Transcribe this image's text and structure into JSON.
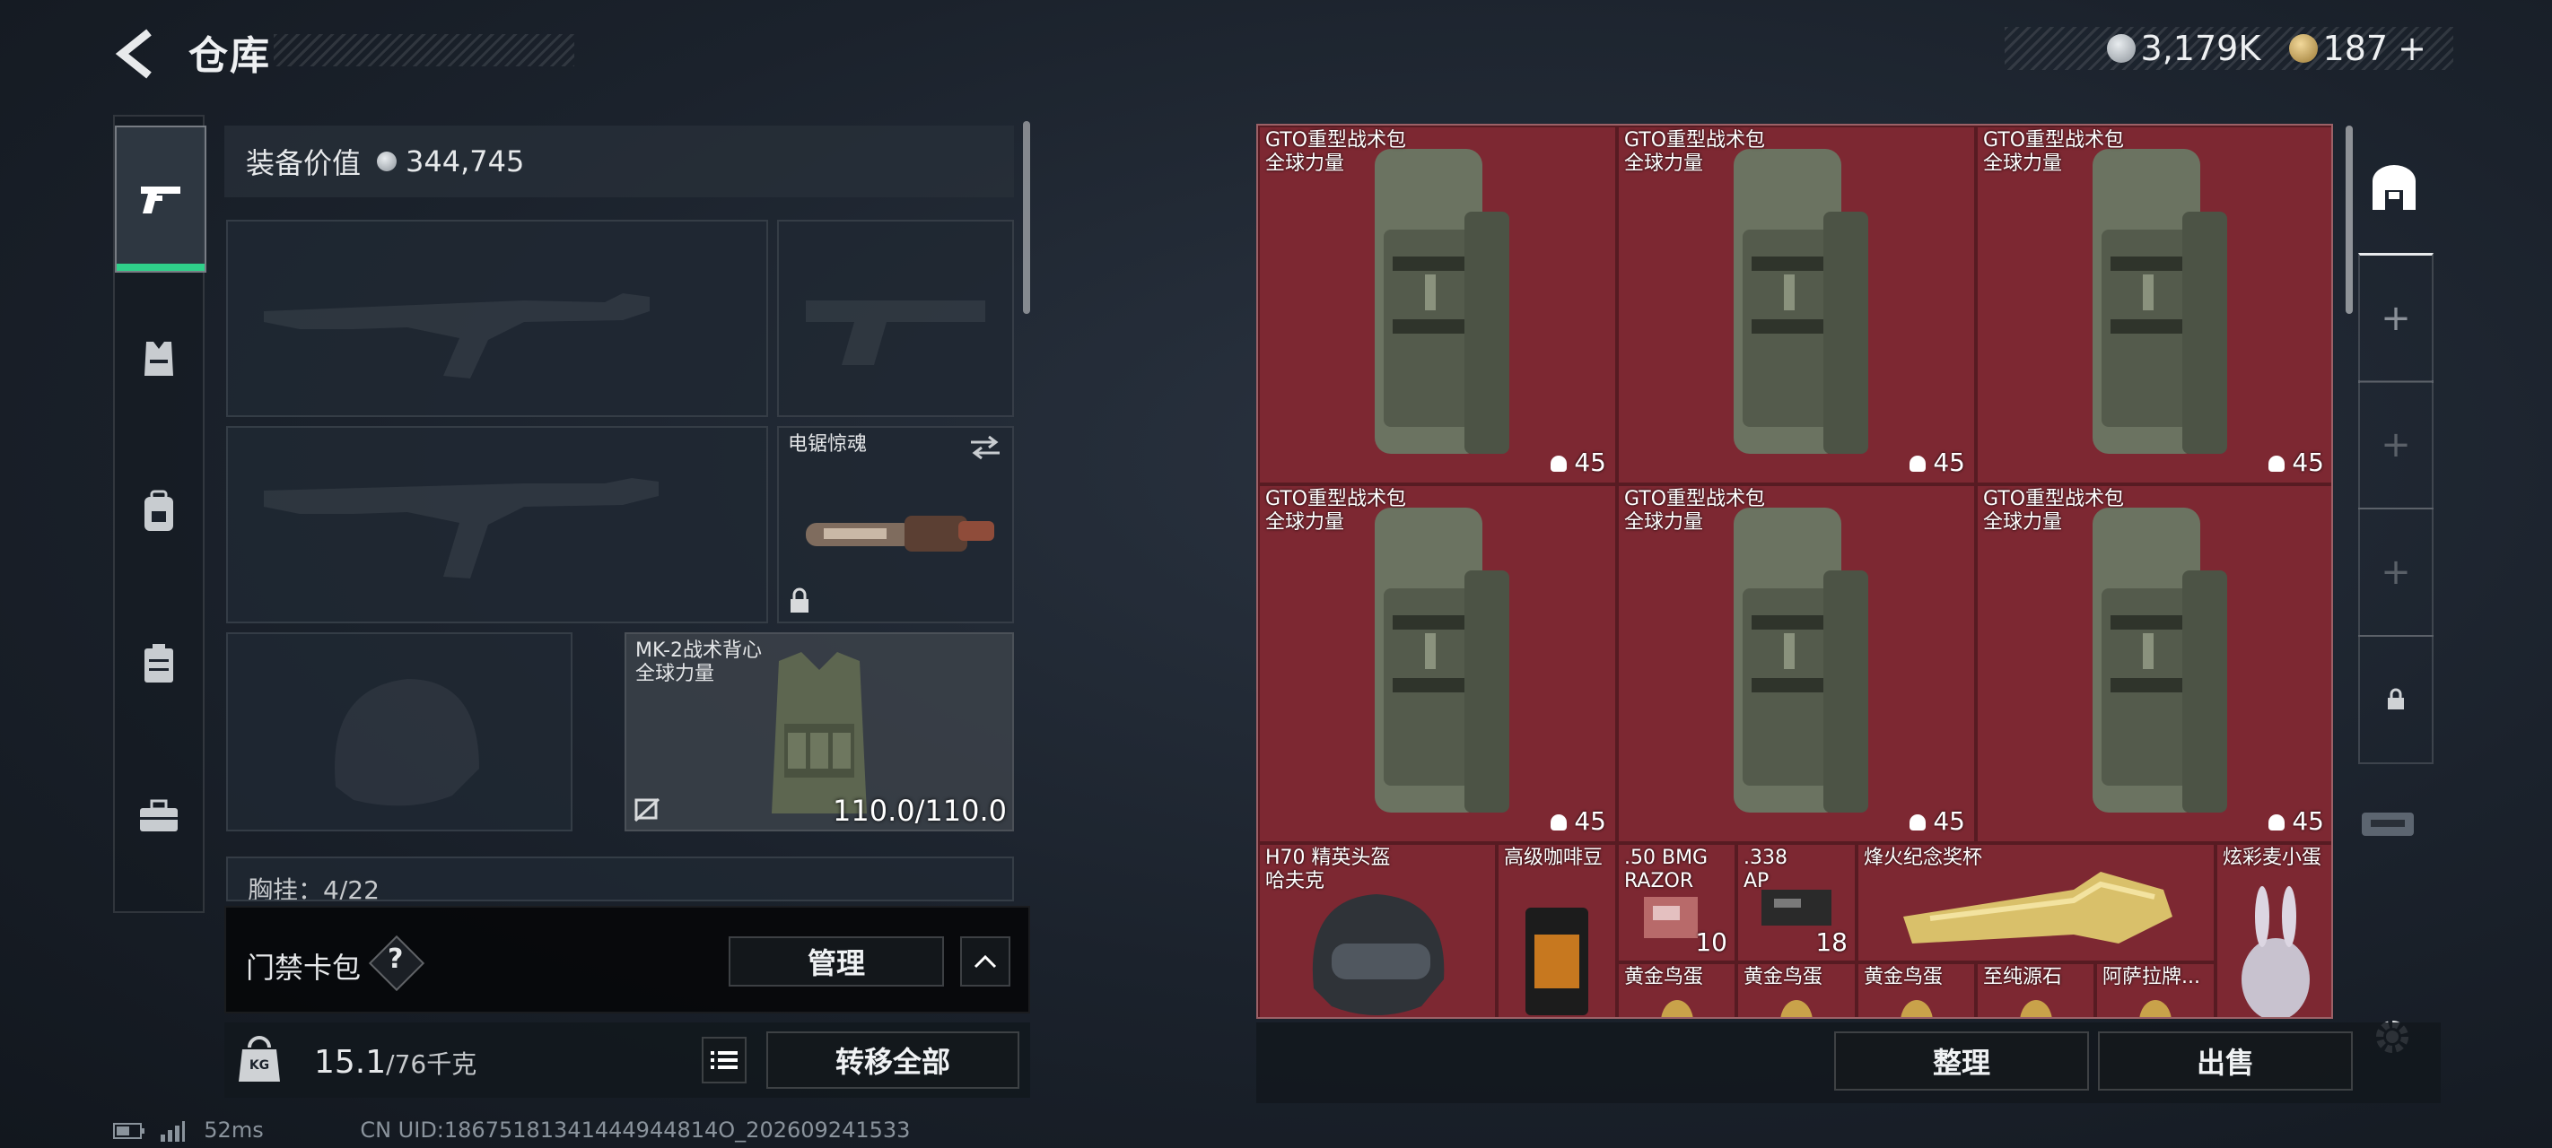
{
  "header": {
    "title": "仓库",
    "currency": [
      {
        "icon": "silver-coin-icon",
        "value": "3,179K",
        "color": "#b9bec4"
      },
      {
        "icon": "gold-triangle-coin-icon",
        "value": "187",
        "color": "#c9a45a"
      }
    ],
    "add_label": "+"
  },
  "rail": {
    "tabs": [
      {
        "icon": "pistol-icon",
        "active": true
      },
      {
        "icon": "vest-icon",
        "active": false
      },
      {
        "icon": "backpack-icon",
        "active": false
      },
      {
        "icon": "case-icon",
        "active": false
      },
      {
        "icon": "briefcase-icon",
        "active": false
      }
    ]
  },
  "loadout": {
    "value_label": "装备价值",
    "value": "344,745",
    "melee": {
      "label": "电锯惊魂"
    },
    "armor": {
      "label": "MK-2战术背心\n全球力量",
      "durability": "110.0/110.0"
    },
    "chest_rig_label": "胸挂：4/22"
  },
  "card_bag": {
    "label": "门禁卡包",
    "help": "?",
    "manage": "管理"
  },
  "weight": {
    "current": "15.1",
    "max": "/76千克",
    "kg_icon_text": "KG",
    "transfer_all": "转移全部"
  },
  "grid": {
    "backpacks": [
      {
        "name": "GTO重型战术包\n全球力量",
        "capacity": "45"
      },
      {
        "name": "GTO重型战术包\n全球力量",
        "capacity": "45"
      },
      {
        "name": "GTO重型战术包\n全球力量",
        "capacity": "45"
      },
      {
        "name": "GTO重型战术包\n全球力量",
        "capacity": "45"
      },
      {
        "name": "GTO重型战术包\n全球力量",
        "capacity": "45"
      },
      {
        "name": "GTO重型战术包\n全球力量",
        "capacity": "45"
      }
    ],
    "items": [
      {
        "name": "H70 精英头盔\n哈夫克"
      },
      {
        "name": "高级咖啡豆"
      },
      {
        "name": ".50 BMG\nRAZOR",
        "qty": "10"
      },
      {
        "name": ".338\nAP",
        "qty": "18"
      },
      {
        "name": "烽火纪念奖杯"
      },
      {
        "name": "炫彩麦小蛋"
      },
      {
        "name": "黄金鸟蛋"
      },
      {
        "name": "黄金鸟蛋"
      },
      {
        "name": "黄金鸟蛋"
      },
      {
        "name": "至纯源石"
      },
      {
        "name": "阿萨拉牌..."
      }
    ]
  },
  "actions": {
    "sort": "整理",
    "sell": "出售"
  },
  "status": {
    "ping": "52ms",
    "uid": "CN UID:18675181341444944814O_202609241533"
  }
}
